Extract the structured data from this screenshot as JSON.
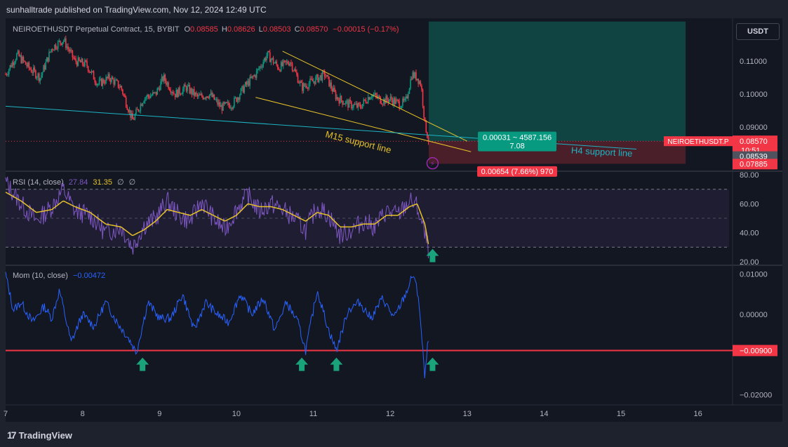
{
  "header": {
    "publisher_line": "sunhalltrade published on TradingView.com, Nov 12, 2024 12:49 UTC"
  },
  "footer": {
    "brand": "TradingView",
    "logo_glyph": "17"
  },
  "currency_button": "USDT",
  "colors": {
    "up": "#089981",
    "down": "#f23645",
    "rsi_line": "#7e57c2",
    "rsi_ma": "#e6c229",
    "mom": "#2962ff",
    "trendline": "#e6c229",
    "support": "#1cb5c3",
    "hline": "#f23645"
  },
  "chart_data": [
    {
      "type": "candlestick",
      "pane": "price",
      "symbol_title": "NEIROETHUSDT Perpetual Contract, 15, BYBIT",
      "ohlc": {
        "o_label": "O",
        "o": "0.08585",
        "h_label": "H",
        "h": "0.08626",
        "l_label": "L",
        "l": "0.08503",
        "c_label": "C",
        "c": "0.08570",
        "change": "−0.00015 (−0.17%)"
      },
      "x_ticks": [
        "7",
        "8",
        "9",
        "10",
        "11",
        "12",
        "13",
        "14",
        "15",
        "16"
      ],
      "y_ticks": [
        "0.11000",
        "0.10000",
        "0.09000"
      ],
      "ylim": [
        0.0768,
        0.123
      ],
      "xlim": [
        7.0,
        16.45
      ],
      "close_path": [
        [
          7.0,
          0.106
        ],
        [
          7.15,
          0.112
        ],
        [
          7.3,
          0.108
        ],
        [
          7.45,
          0.105
        ],
        [
          7.6,
          0.114
        ],
        [
          7.75,
          0.1165
        ],
        [
          7.9,
          0.11
        ],
        [
          8.05,
          0.109
        ],
        [
          8.2,
          0.103
        ],
        [
          8.35,
          0.105
        ],
        [
          8.5,
          0.102
        ],
        [
          8.65,
          0.092
        ],
        [
          8.8,
          0.099
        ],
        [
          8.95,
          0.1
        ],
        [
          9.05,
          0.105
        ],
        [
          9.2,
          0.1
        ],
        [
          9.35,
          0.102
        ],
        [
          9.5,
          0.099
        ],
        [
          9.65,
          0.1
        ],
        [
          9.8,
          0.096
        ],
        [
          9.95,
          0.097
        ],
        [
          10.1,
          0.102
        ],
        [
          10.25,
          0.106
        ],
        [
          10.4,
          0.112
        ],
        [
          10.55,
          0.108
        ],
        [
          10.7,
          0.11
        ],
        [
          10.85,
          0.102
        ],
        [
          11.0,
          0.104
        ],
        [
          11.15,
          0.106
        ],
        [
          11.3,
          0.099
        ],
        [
          11.45,
          0.097
        ],
        [
          11.6,
          0.096
        ],
        [
          11.75,
          0.1
        ],
        [
          11.9,
          0.098
        ],
        [
          12.0,
          0.0985
        ],
        [
          12.12,
          0.097
        ],
        [
          12.2,
          0.0975
        ],
        [
          12.28,
          0.106
        ],
        [
          12.35,
          0.105
        ],
        [
          12.4,
          0.103
        ],
        [
          12.45,
          0.091
        ],
        [
          12.5,
          0.0857
        ]
      ],
      "title_hint": "",
      "annotations": [
        {
          "text": "M15 support line",
          "kind": "label"
        },
        {
          "text": "H4 support line",
          "kind": "label"
        }
      ],
      "position_tool": {
        "target_label_line1": "0.00031 ~ 4587.156",
        "target_label_line2": "7.08",
        "stop_label": "0.00654 (7.66%) 970",
        "entry": 0.0857,
        "take_profit": 0.122,
        "stop": 0.07885
      },
      "price_tags": [
        {
          "text": "NEIROETHUSDT.P",
          "value": "0.08570",
          "countdown": "10:51",
          "color": "#f23645"
        },
        {
          "text": "",
          "value": "0.08539",
          "color": "#50535e"
        },
        {
          "text": "",
          "value": "0.07885",
          "color": "#f23645"
        }
      ],
      "legend_position": "top-left",
      "grid": false
    },
    {
      "type": "line",
      "pane": "rsi",
      "legend": {
        "name": "RSI (14, close)",
        "v1": "27.84",
        "v2": "31.35",
        "v3": "∅",
        "v4": "∅"
      },
      "y_ticks": [
        "80.00",
        "60.00",
        "40.00",
        "20.00"
      ],
      "ylim": [
        18,
        82
      ],
      "bands": {
        "upper": 70,
        "middle": 50,
        "lower": 30
      },
      "rsi_path": [
        [
          7.0,
          75
        ],
        [
          7.2,
          60
        ],
        [
          7.4,
          48
        ],
        [
          7.6,
          58
        ],
        [
          7.75,
          70
        ],
        [
          7.9,
          55
        ],
        [
          8.1,
          52
        ],
        [
          8.3,
          40
        ],
        [
          8.5,
          44
        ],
        [
          8.65,
          30
        ],
        [
          8.8,
          45
        ],
        [
          8.95,
          50
        ],
        [
          9.1,
          62
        ],
        [
          9.25,
          52
        ],
        [
          9.4,
          48
        ],
        [
          9.55,
          62
        ],
        [
          9.7,
          50
        ],
        [
          9.85,
          42
        ],
        [
          10.0,
          56
        ],
        [
          10.15,
          66
        ],
        [
          10.3,
          55
        ],
        [
          10.45,
          60
        ],
        [
          10.6,
          56
        ],
        [
          10.75,
          50
        ],
        [
          10.9,
          42
        ],
        [
          11.05,
          58
        ],
        [
          11.2,
          52
        ],
        [
          11.35,
          38
        ],
        [
          11.5,
          42
        ],
        [
          11.65,
          48
        ],
        [
          11.8,
          44
        ],
        [
          11.95,
          55
        ],
        [
          12.1,
          52
        ],
        [
          12.25,
          62
        ],
        [
          12.35,
          58
        ],
        [
          12.45,
          38
        ],
        [
          12.5,
          28
        ]
      ],
      "rsi_ma_path": [
        [
          7.0,
          68
        ],
        [
          7.2,
          62
        ],
        [
          7.4,
          54
        ],
        [
          7.6,
          56
        ],
        [
          7.75,
          62
        ],
        [
          7.9,
          58
        ],
        [
          8.1,
          54
        ],
        [
          8.3,
          46
        ],
        [
          8.5,
          44
        ],
        [
          8.65,
          38
        ],
        [
          8.8,
          42
        ],
        [
          8.95,
          48
        ],
        [
          9.1,
          56
        ],
        [
          9.25,
          54
        ],
        [
          9.4,
          52
        ],
        [
          9.55,
          56
        ],
        [
          9.7,
          52
        ],
        [
          9.85,
          48
        ],
        [
          10.0,
          52
        ],
        [
          10.15,
          60
        ],
        [
          10.3,
          58
        ],
        [
          10.45,
          58
        ],
        [
          10.6,
          56
        ],
        [
          10.75,
          52
        ],
        [
          10.9,
          48
        ],
        [
          11.05,
          54
        ],
        [
          11.2,
          52
        ],
        [
          11.35,
          44
        ],
        [
          11.5,
          44
        ],
        [
          11.65,
          46
        ],
        [
          11.8,
          46
        ],
        [
          11.95,
          52
        ],
        [
          12.1,
          52
        ],
        [
          12.25,
          58
        ],
        [
          12.35,
          60
        ],
        [
          12.45,
          46
        ],
        [
          12.5,
          31
        ]
      ]
    },
    {
      "type": "line",
      "pane": "momentum",
      "legend": {
        "name": "Mom (10, close)",
        "value": "−0.00472"
      },
      "y_ticks": [
        "0.01000",
        "0.00000",
        "−0.02000"
      ],
      "hline_label": "−0.00900",
      "hline_value": -0.009,
      "ylim": [
        -0.0225,
        0.012
      ],
      "mom_path": [
        [
          7.0,
          0.01
        ],
        [
          7.1,
          0.001
        ],
        [
          7.2,
          0.003
        ],
        [
          7.35,
          -0.002
        ],
        [
          7.5,
          0.002
        ],
        [
          7.6,
          -0.001
        ],
        [
          7.7,
          0.006
        ],
        [
          7.85,
          -0.007
        ],
        [
          8.0,
          0.0
        ],
        [
          8.15,
          -0.003
        ],
        [
          8.3,
          0.003
        ],
        [
          8.45,
          -0.002
        ],
        [
          8.6,
          -0.006
        ],
        [
          8.7,
          -0.0095
        ],
        [
          8.85,
          0.003
        ],
        [
          9.0,
          -0.001
        ],
        [
          9.15,
          -0.001
        ],
        [
          9.3,
          0.005
        ],
        [
          9.45,
          -0.004
        ],
        [
          9.6,
          0.003
        ],
        [
          9.75,
          0.0
        ],
        [
          9.9,
          -0.002
        ],
        [
          10.05,
          0.005
        ],
        [
          10.2,
          0.0
        ],
        [
          10.35,
          0.004
        ],
        [
          10.5,
          -0.004
        ],
        [
          10.65,
          0.003
        ],
        [
          10.8,
          -0.002
        ],
        [
          10.9,
          -0.009
        ],
        [
          11.05,
          0.006
        ],
        [
          11.2,
          -0.004
        ],
        [
          11.3,
          -0.009
        ],
        [
          11.45,
          0.001
        ],
        [
          11.6,
          0.003
        ],
        [
          11.75,
          -0.001
        ],
        [
          11.9,
          0.004
        ],
        [
          12.05,
          -0.001
        ],
        [
          12.2,
          0.005
        ],
        [
          12.3,
          0.01
        ],
        [
          12.37,
          0.004
        ],
        [
          12.45,
          -0.016
        ],
        [
          12.5,
          -0.0047
        ]
      ],
      "arrows_at_x": [
        8.78,
        10.85,
        11.3,
        12.55
      ]
    }
  ]
}
